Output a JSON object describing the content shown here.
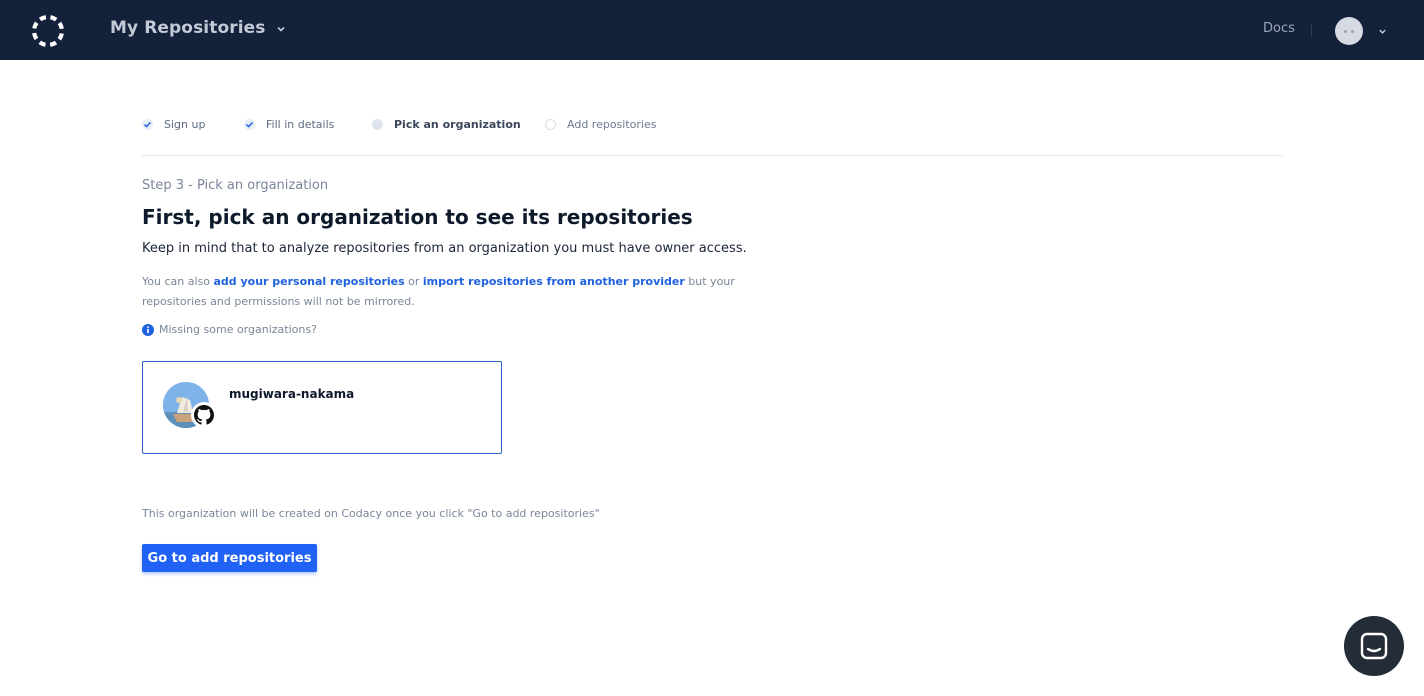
{
  "header": {
    "title": "My Repositories",
    "docs_label": "Docs",
    "logo_icon": "codacy-logo-icon",
    "bg_color": "#14213a"
  },
  "steps": [
    {
      "label": "Sign up",
      "state": "done"
    },
    {
      "label": "Fill in details",
      "state": "done"
    },
    {
      "label": "Pick an organization",
      "state": "current"
    },
    {
      "label": "Add repositories",
      "state": "todo"
    }
  ],
  "main": {
    "step_label": "Step 3 - Pick an organization",
    "headline": "First, pick an organization to see its repositories",
    "subline": "Keep in mind that to analyze repositories from an organization you must have owner access.",
    "note_prefix": "You can also ",
    "note_link1": "add your personal repositories",
    "note_mid": " or ",
    "note_link2": "import repositories from another provider",
    "note_suffix": " but your repositories and permissions will not be mirrored.",
    "missing_label": "Missing some organizations?",
    "footnote": "This organization will be created on Codacy once you click \"Go to add repositories\"",
    "cta_label": "Go to add repositories"
  },
  "organizations": [
    {
      "name": "mugiwara-nakama",
      "provider_icon": "github-icon",
      "selected": true
    }
  ],
  "colors": {
    "accent": "#1f62f5",
    "link": "#1f62e0",
    "card_border": "#2f62c9"
  },
  "chat": {
    "icon": "chat-icon"
  }
}
